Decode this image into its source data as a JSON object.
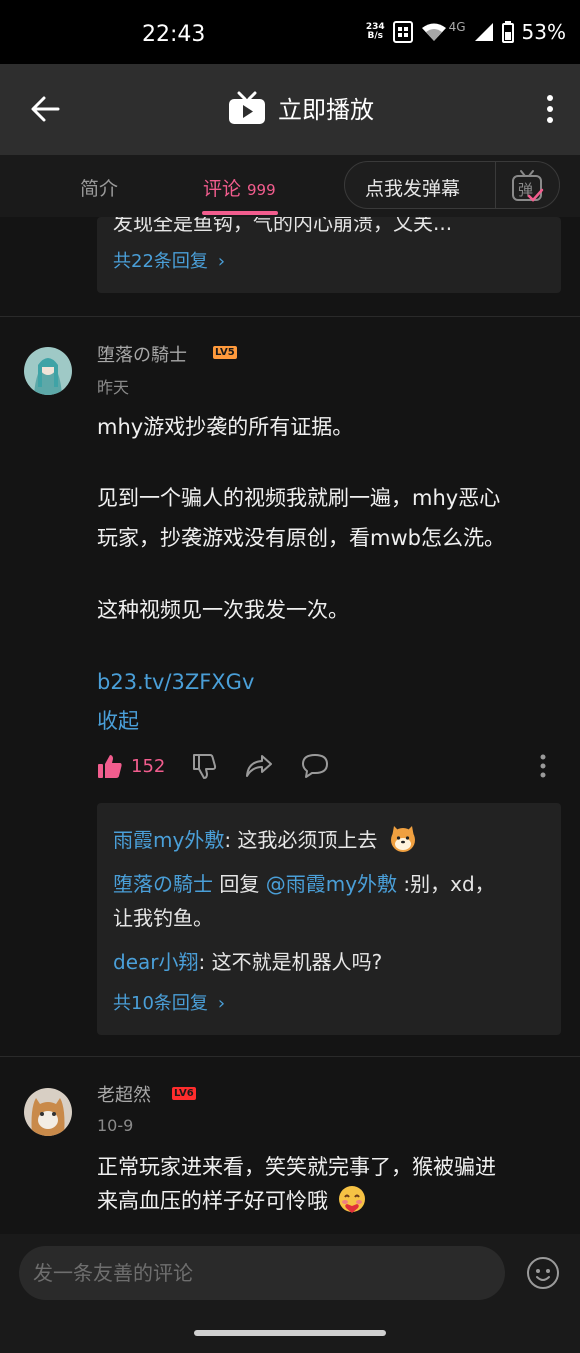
{
  "status_bar": {
    "time": "22:43",
    "net_speed_value": "234",
    "net_speed_unit": "B/s",
    "network": "4G",
    "battery": "53%"
  },
  "app_bar": {
    "title": "立即播放",
    "icons": [
      "back-arrow-icon",
      "tv-icon",
      "more-vertical-icon"
    ]
  },
  "tabs": {
    "intro": "简介",
    "comments": "评论",
    "comments_count": "999",
    "danmaku_button": "点我发弹幕",
    "danmaku_icon_text": "弹"
  },
  "prev_comment": {
    "partial_text": "发现全是鱼钩，气的内心崩溃，又关...",
    "more_replies": "共22条回复"
  },
  "comment1": {
    "username": "堕落の騎士",
    "level": "LV5",
    "date": "昨天",
    "lines": [
      "mhy游戏抄袭的所有证据。",
      "见到一个骗人的视频我就刷一遍，mhy恶心",
      "玩家，抄袭游戏没有原创，看mwb怎么洗。",
      "这种视频见一次我发一次。"
    ],
    "link": "b23.tv/3ZFXGv",
    "collapse": "收起",
    "likes": "152",
    "replies": [
      {
        "name": "雨霞my外敷",
        "text": ": 这我必须顶上去"
      },
      {
        "name": "堕落の騎士",
        "mid": " 回复 ",
        "target": "@雨霞my外敷",
        "text": " :别，xd，",
        "text2": "让我钓鱼。"
      },
      {
        "name": "dear小翔",
        "text": ": 这不就是机器人吗?"
      }
    ],
    "more_replies": "共10条回复"
  },
  "comment2": {
    "username": "老超然",
    "level": "LV6",
    "date": "10-9",
    "lines": [
      "正常玩家进来看，笑笑就完事了，猴被骗进",
      "来高血压的样子好可怜哦"
    ]
  },
  "bottom_bar": {
    "input_placeholder": "发一条友善的评论"
  },
  "colors": {
    "accent_pink": "#f25d8e",
    "link_blue": "#4a9fd8",
    "lv5": "#ff9a3c",
    "lv6": "#ff2d2d"
  }
}
